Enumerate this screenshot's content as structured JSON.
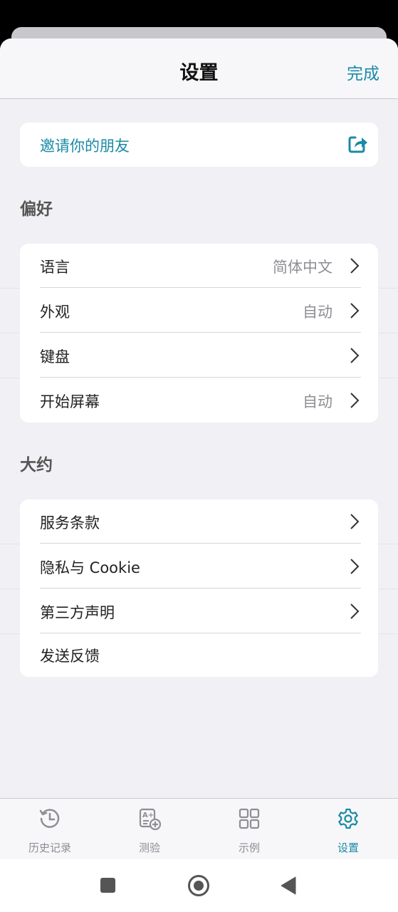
{
  "header": {
    "title": "设置",
    "done_label": "完成"
  },
  "invite": {
    "label": "邀请你的朋友",
    "icon": "share-icon"
  },
  "sections": [
    {
      "title": "偏好",
      "rows": [
        {
          "label": "语言",
          "value": "简体中文"
        },
        {
          "label": "外观",
          "value": "自动"
        },
        {
          "label": "键盘",
          "value": ""
        },
        {
          "label": "开始屏幕",
          "value": "自动"
        }
      ]
    },
    {
      "title": "大约",
      "rows": [
        {
          "label": "服务条款"
        },
        {
          "label": "隐私与 Cookie"
        },
        {
          "label": "第三方声明"
        },
        {
          "label": "发送反馈"
        }
      ]
    }
  ],
  "tabs": [
    {
      "label": "历史记录",
      "icon": "history-icon"
    },
    {
      "label": "测验",
      "icon": "quiz-icon"
    },
    {
      "label": "示例",
      "icon": "examples-grid-icon"
    },
    {
      "label": "设置",
      "icon": "gear-icon",
      "active": true
    }
  ],
  "colors": {
    "accent": "#1a8aa6",
    "background": "#f1f0f5",
    "card": "#ffffff"
  }
}
